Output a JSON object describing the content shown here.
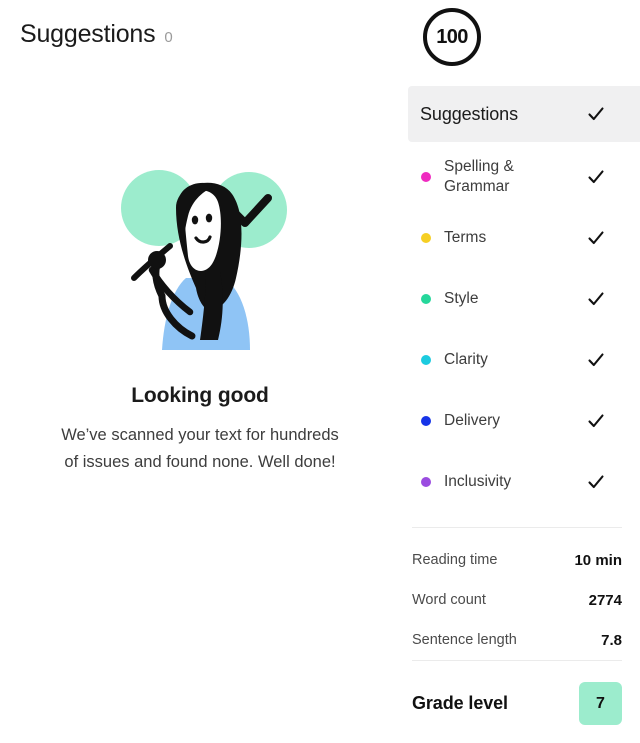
{
  "left": {
    "header": {
      "title": "Suggestions",
      "count": "0"
    },
    "empty_state": {
      "title": "Looking good",
      "body": "We’ve scanned your text for hundreds of issues and found none. Well done!",
      "illustration_name": "person-writing-illustration",
      "badge_icon": "check-circle-icon",
      "colors": {
        "mint": "#9ceccd",
        "shirt_blue": "#8fc4f5",
        "ink": "#111111"
      }
    }
  },
  "right": {
    "score": {
      "value": "100",
      "ring_color": "#111111"
    },
    "suggestions_row": {
      "label": "Suggestions",
      "check_icon": "check-icon",
      "highlight_color": "#f0f0f1"
    },
    "categories": [
      {
        "label": "Spelling & Grammar",
        "color": "#ef2bc0",
        "check_icon": "check-icon"
      },
      {
        "label": "Terms",
        "color": "#f6cf24",
        "check_icon": "check-icon"
      },
      {
        "label": "Style",
        "color": "#25d79b",
        "check_icon": "check-icon"
      },
      {
        "label": "Clarity",
        "color": "#1ccbdf",
        "check_icon": "check-icon"
      },
      {
        "label": "Delivery",
        "color": "#1634e8",
        "check_icon": "check-icon"
      },
      {
        "label": "Inclusivity",
        "color": "#9a4ce0",
        "check_icon": "check-icon"
      }
    ],
    "stats": [
      {
        "label": "Reading time",
        "value": "10 min"
      },
      {
        "label": "Word count",
        "value": "2774"
      },
      {
        "label": "Sentence length",
        "value": "7.8"
      }
    ],
    "grade": {
      "label": "Grade level",
      "value": "7",
      "badge_color": "#9ceccd"
    }
  }
}
